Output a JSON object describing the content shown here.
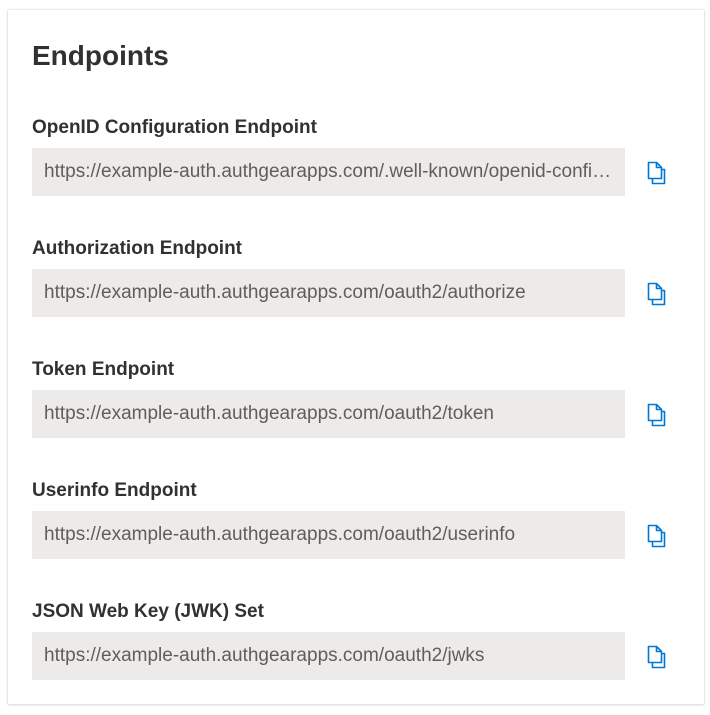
{
  "card": {
    "title": "Endpoints"
  },
  "endpoints": [
    {
      "label": "OpenID Configuration Endpoint",
      "value": "https://example-auth.authgearapps.com/.well-known/openid-configuration"
    },
    {
      "label": "Authorization Endpoint",
      "value": "https://example-auth.authgearapps.com/oauth2/authorize"
    },
    {
      "label": "Token Endpoint",
      "value": "https://example-auth.authgearapps.com/oauth2/token"
    },
    {
      "label": "Userinfo Endpoint",
      "value": "https://example-auth.authgearapps.com/oauth2/userinfo"
    },
    {
      "label": "JSON Web Key (JWK) Set",
      "value": "https://example-auth.authgearapps.com/oauth2/jwks"
    }
  ],
  "icons": {
    "copy": "copy-icon"
  },
  "colors": {
    "accent": "#0078d4",
    "field_background": "#edebe9",
    "text": "#323130"
  }
}
